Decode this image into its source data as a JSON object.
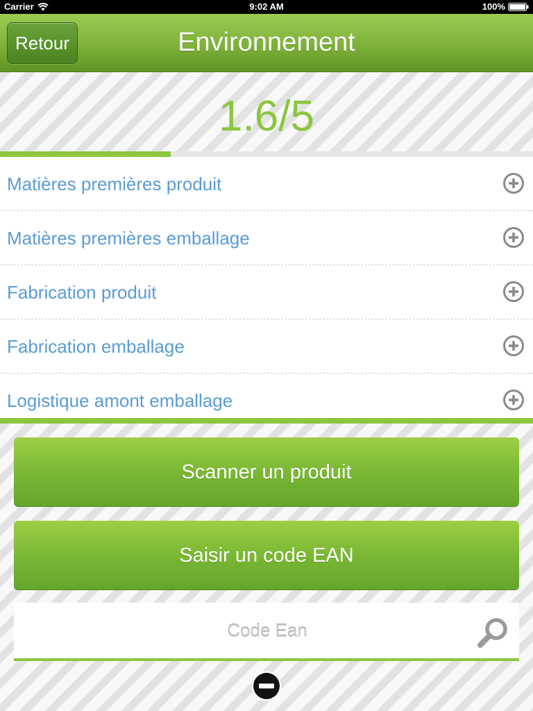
{
  "status_bar": {
    "carrier": "Carrier",
    "time": "9:02 AM",
    "battery": "100%",
    "icons": [
      "wifi-icon",
      "battery-icon"
    ]
  },
  "nav": {
    "back_label": "Retour",
    "title": "Environnement"
  },
  "score": {
    "text": "1.6/5",
    "value": 1.6,
    "max": 5
  },
  "list": {
    "items": [
      {
        "label": "Matières premières produit",
        "icon": "plus-circle-icon"
      },
      {
        "label": "Matières premières emballage",
        "icon": "plus-circle-icon"
      },
      {
        "label": "Fabrication produit",
        "icon": "plus-circle-icon"
      },
      {
        "label": "Fabrication emballage",
        "icon": "plus-circle-icon"
      },
      {
        "label": "Logistique amont emballage",
        "icon": "plus-circle-icon"
      }
    ]
  },
  "actions": {
    "scan_label": "Scanner un produit",
    "ean_label": "Saisir un code EAN"
  },
  "ean_input": {
    "placeholder": "Code Ean",
    "value": "",
    "icon": "search-icon"
  },
  "collapse_icon": "minus-circle-icon",
  "colors": {
    "accent": "#8cc63f",
    "link": "#5b9bd5",
    "nav_green": "#7fb23a"
  }
}
